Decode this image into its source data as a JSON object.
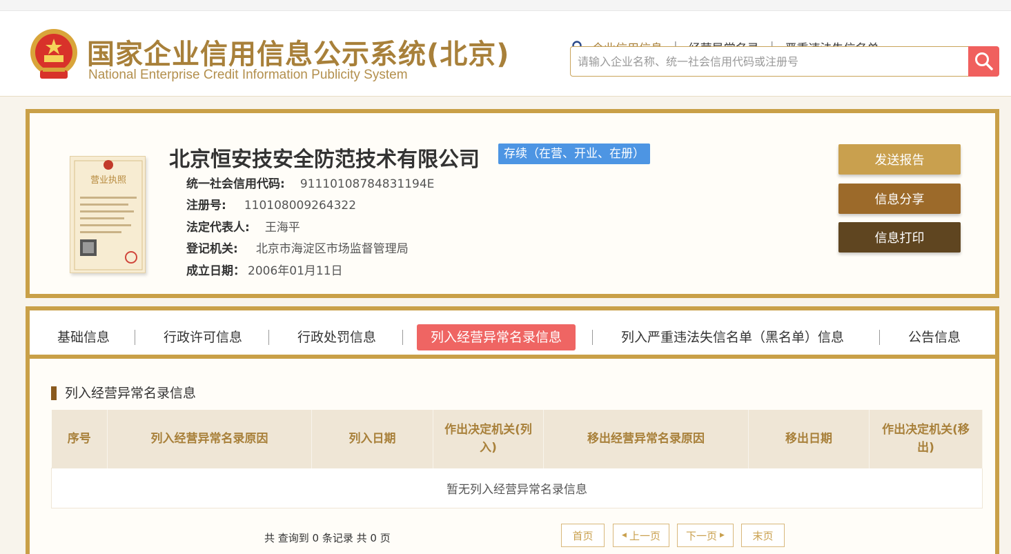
{
  "header": {
    "title_cn": "国家企业信用信息公示系统(北京)",
    "title_en": "National Enterprise Credit Information Publicity System",
    "links": [
      "企业信用信息",
      "经营异常名录",
      "严重违法失信名单"
    ],
    "search_placeholder": "请输入企业名称、统一社会信用代码或注册号"
  },
  "company": {
    "name": "北京恒安技安全防范技术有限公司",
    "status": "存续（在营、开业、在册）",
    "fields": [
      {
        "label": "统一社会信用代码:",
        "value": "91110108784831194E"
      },
      {
        "label": "注册号:",
        "value": "110108009264322"
      },
      {
        "label": "法定代表人:",
        "value": "王海平"
      },
      {
        "label": "登记机关:",
        "value": "北京市海淀区市场监督管理局"
      },
      {
        "label": "成立日期：",
        "value": "2006年01月11日"
      }
    ],
    "license_title": "营业执照",
    "buttons": {
      "send": "发送报告",
      "share": "信息分享",
      "print": "信息打印"
    }
  },
  "tabs": [
    "基础信息",
    "行政许可信息",
    "行政处罚信息",
    "列入经营异常名录信息",
    "列入严重违法失信名单（黑名单）信息",
    "公告信息"
  ],
  "active_tab": 3,
  "section": {
    "title": "列入经营异常名录信息",
    "columns": [
      "序号",
      "列入经营异常名录原因",
      "列入日期",
      "作出决定机关(列入)",
      "移出经营异常名录原因",
      "移出日期",
      "作出决定机关(移出)"
    ],
    "empty_text": "暂无列入经营异常名录信息"
  },
  "pagination": {
    "summary": "共 查询到 0 条记录 共 0 页",
    "first": "首页",
    "prev": "上一页",
    "next": "下一页",
    "last": "末页"
  },
  "colors": {
    "gold": "#c9a048",
    "accent_red": "#ef6563",
    "status_blue": "#4d95e3"
  }
}
